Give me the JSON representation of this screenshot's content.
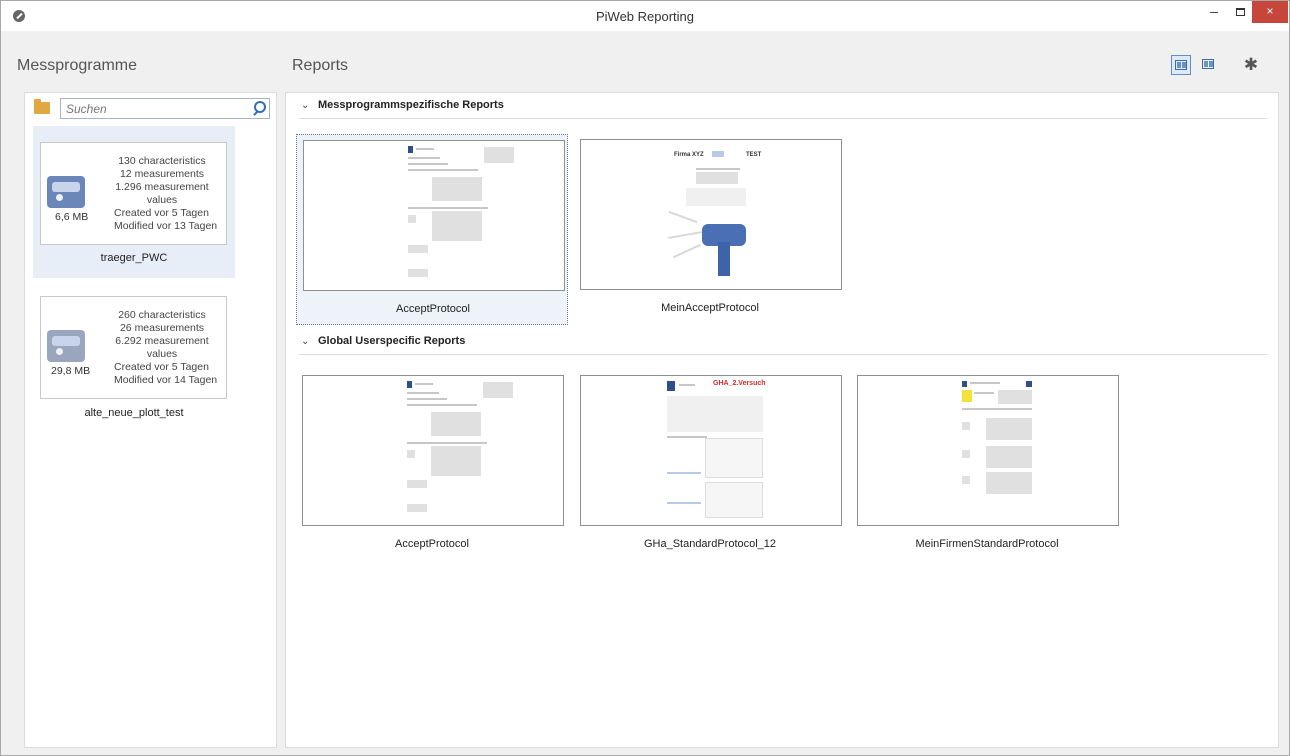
{
  "window": {
    "title": "PiWeb Reporting",
    "minimize_glyph": "–",
    "close_glyph": "×"
  },
  "header": {
    "left_title": "Messprogramme",
    "right_title": "Reports"
  },
  "search": {
    "placeholder": "Suchen"
  },
  "programs": [
    {
      "characteristics": "130 characteristics",
      "measurements": "12 measurements",
      "values": "1.296 measurement values",
      "size": "6,6 MB",
      "created": "Created vor 5 Tagen",
      "modified": "Modified vor 13 Tagen",
      "name": "traeger_PWC"
    },
    {
      "characteristics": "260 characteristics",
      "measurements": "26 measurements",
      "values": "6.292 measurement values",
      "size": "29,8 MB",
      "created": "Created vor 5 Tagen",
      "modified": "Modified vor 14 Tagen",
      "name": "alte_neue_plott_test"
    }
  ],
  "sections": [
    {
      "label": "Messprogrammspezifische Reports",
      "reports": [
        {
          "name": "AcceptProtocol"
        },
        {
          "name": "MeinAcceptProtocol"
        }
      ]
    },
    {
      "label": "Global Userspecific Reports",
      "reports": [
        {
          "name": "AcceptProtocol"
        },
        {
          "name": "GHa_StandardProtocol_12"
        },
        {
          "name": "MeinFirmenStandardProtocol"
        }
      ]
    }
  ],
  "thumb_text": {
    "firma": "Firma XYZ",
    "test": "TEST",
    "versuch": "GHA_2.Versuch"
  },
  "colors": {
    "selection_bg": "#e7eef8",
    "close_button": "#c7463c",
    "accent": "#2f6fb0"
  }
}
